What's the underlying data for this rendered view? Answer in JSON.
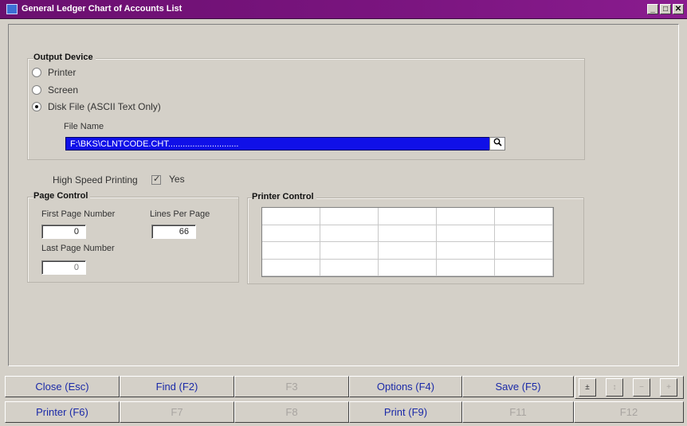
{
  "window": {
    "title": "General Ledger Chart of Accounts List",
    "controls": [
      "_",
      "□",
      "✕"
    ]
  },
  "output_device": {
    "label": "Output Device",
    "options": [
      "Printer",
      "Screen",
      "Disk File (ASCII Text Only)"
    ],
    "selected": "Disk File (ASCII Text Only)",
    "file_name_label": "File Name",
    "file_name_value": "F:\\BKS\\CLNTCODE.CHT.............................",
    "lookup_icon": "magnifier-icon"
  },
  "high_speed": {
    "label": "High Speed Printing",
    "checked": true,
    "value_label": "Yes"
  },
  "page_control": {
    "label": "Page Control",
    "first_page_label": "First Page Number",
    "first_page_value": "0",
    "lines_per_page_label": "Lines Per Page",
    "lines_per_page_value": "66",
    "last_page_label": "Last Page Number",
    "last_page_value": "0"
  },
  "printer_control": {
    "label": "Printer Control"
  },
  "function_keys": {
    "row1": [
      "Close (Esc)",
      "Find (F2)",
      "F3",
      "Options (F4)",
      "Save (F5)"
    ],
    "row2": [
      "Printer (F6)",
      "F7",
      "F8",
      "Print (F9)",
      "F11",
      "F12"
    ],
    "nav": [
      "±",
      "↕",
      "−",
      "+"
    ]
  }
}
